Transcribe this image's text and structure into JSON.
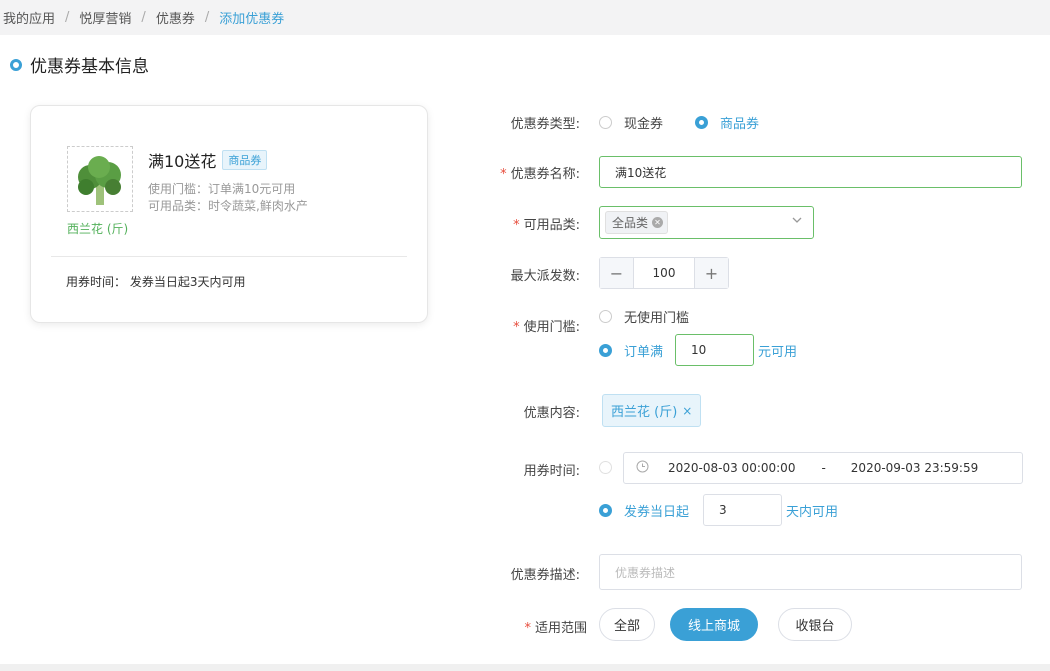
{
  "breadcrumb": [
    "我的应用",
    "悦厚营销",
    "优惠券",
    "添加优惠券"
  ],
  "section_title": "优惠券基本信息",
  "preview": {
    "image_caption": "西兰花 (斤)",
    "name": "满10送花",
    "type_tag": "商品券",
    "threshold_line": "使用门槛：订单满10元可用",
    "category_line": "可用品类：时令蔬菜,鲜肉水产",
    "time_line": "用券时间： 发券当日起3天内可用"
  },
  "form": {
    "coupon_type": {
      "label": "优惠券类型:",
      "options": [
        "现金券",
        "商品券"
      ],
      "selected": "商品券"
    },
    "coupon_name": {
      "label": "优惠券名称:",
      "value": "满10送花"
    },
    "category": {
      "label": "可用品类:",
      "chip": "全品类"
    },
    "max_count": {
      "label": "最大派发数:",
      "value": "100",
      "minus": "−",
      "plus": "+"
    },
    "threshold": {
      "label": "使用门槛:",
      "none_option": "无使用门槛",
      "order_prefix": "订单满",
      "order_value": "10",
      "order_suffix": "元可用"
    },
    "content": {
      "label": "优惠内容:",
      "tag": "西兰花 (斤)",
      "remove": "×"
    },
    "use_time": {
      "label": "用券时间:",
      "start": "2020-08-03 00:00:00",
      "range_sep": "-",
      "end": "2020-09-03 23:59:59",
      "relative_prefix": "发券当日起",
      "relative_value": "3",
      "relative_suffix": "天内可用"
    },
    "description": {
      "label": "优惠券描述:",
      "placeholder": "优惠券描述"
    },
    "scope": {
      "label": "适用范围",
      "options": [
        "全部",
        "线上商城",
        "收银台"
      ],
      "selected": "线上商城"
    }
  },
  "colors": {
    "accent": "#3aa0d6",
    "required": "#e74c3c",
    "valid_border": "#6abf69",
    "caption_green": "#52b05a"
  }
}
